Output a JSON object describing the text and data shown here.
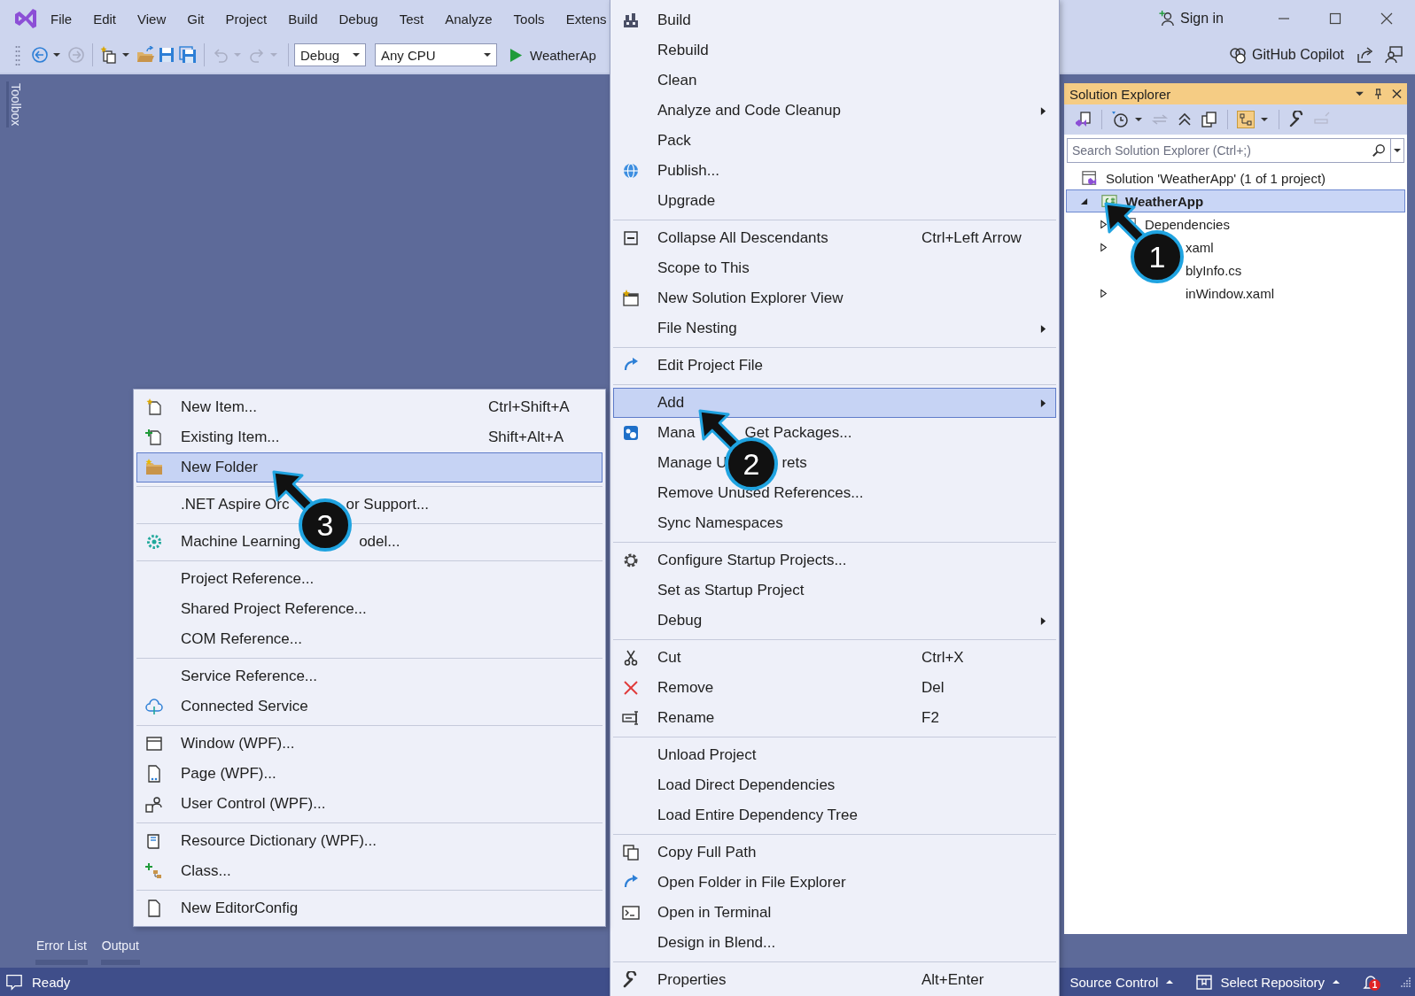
{
  "menu_bar": [
    "File",
    "Edit",
    "View",
    "Git",
    "Project",
    "Build",
    "Debug",
    "Test",
    "Analyze",
    "Tools",
    "Extens"
  ],
  "title_bar": {
    "sign_in": "Sign in"
  },
  "toolbar": {
    "configuration": "Debug",
    "platform": "Any CPU",
    "run_target": "WeatherAp",
    "copilot": "GitHub Copilot"
  },
  "toolbox_tab": "Toolbox",
  "solution_explorer": {
    "title": "Solution Explorer",
    "search": {
      "placeholder": "Search Solution Explorer (Ctrl+;)"
    },
    "tree": [
      {
        "label": "Solution 'WeatherApp' (1 of 1 project)",
        "selected": false,
        "children": [
          {
            "label": "WeatherApp",
            "selected": true,
            "expanded": true,
            "children": [
              {
                "label": "Dependencies",
                "selected": false,
                "expanded": false
              },
              {
                "label": "xaml",
                "selected": false,
                "expanded": false,
                "partly_hidden": true
              },
              {
                "label": "blyInfo.cs",
                "selected": false,
                "partly_hidden": true
              },
              {
                "label": "inWindow.xaml",
                "selected": false,
                "expanded": false,
                "partly_hidden": true
              }
            ]
          }
        ]
      }
    ]
  },
  "bottom_tabs": [
    "Error List",
    "Output"
  ],
  "status_bar": {
    "text": "Ready",
    "source_control": "Source Control",
    "repository": "Select Repository",
    "notifications": "1"
  },
  "context_menu": {
    "items": [
      {
        "kind": "item",
        "label": "Build",
        "submenu": false,
        "selected": false
      },
      {
        "kind": "item",
        "label": "Rebuild",
        "submenu": false,
        "selected": false
      },
      {
        "kind": "item",
        "label": "Clean",
        "submenu": false,
        "selected": false
      },
      {
        "kind": "item",
        "label": "Analyze and Code Cleanup",
        "submenu": true,
        "selected": false
      },
      {
        "kind": "item",
        "label": "Pack",
        "submenu": false,
        "selected": false
      },
      {
        "kind": "item",
        "label": "Publish...",
        "submenu": false,
        "selected": false
      },
      {
        "kind": "item",
        "label": "Upgrade",
        "submenu": false,
        "selected": false
      },
      {
        "kind": "separator"
      },
      {
        "kind": "item",
        "label": "Collapse All Descendants",
        "shortcut": "Ctrl+Left Arrow",
        "submenu": false,
        "selected": false
      },
      {
        "kind": "item",
        "label": "Scope to This",
        "submenu": false,
        "selected": false
      },
      {
        "kind": "item",
        "label": "New Solution Explorer View",
        "submenu": false,
        "selected": false
      },
      {
        "kind": "item",
        "label": "File Nesting",
        "submenu": true,
        "selected": false
      },
      {
        "kind": "separator"
      },
      {
        "kind": "item",
        "label": "Edit Project File",
        "submenu": false,
        "selected": false
      },
      {
        "kind": "separator"
      },
      {
        "kind": "item",
        "label": "Add",
        "submenu": true,
        "selected": true
      },
      {
        "kind": "item",
        "label": "Mana",
        "label_after_gap": "Get Packages...",
        "submenu": false,
        "selected": false
      },
      {
        "kind": "item",
        "label": "Manage U",
        "label_after_gap": "rets",
        "submenu": false,
        "selected": false
      },
      {
        "kind": "item",
        "label": "Remove Unused References...",
        "submenu": false,
        "selected": false
      },
      {
        "kind": "item",
        "label": "Sync Namespaces",
        "submenu": false,
        "selected": false
      },
      {
        "kind": "separator"
      },
      {
        "kind": "item",
        "label": "Configure Startup Projects...",
        "submenu": false,
        "selected": false
      },
      {
        "kind": "item",
        "label": "Set as Startup Project",
        "submenu": false,
        "selected": false
      },
      {
        "kind": "item",
        "label": "Debug",
        "submenu": true,
        "selected": false
      },
      {
        "kind": "separator"
      },
      {
        "kind": "item",
        "label": "Cut",
        "shortcut": "Ctrl+X",
        "submenu": false,
        "selected": false
      },
      {
        "kind": "item",
        "label": "Remove",
        "shortcut": "Del",
        "submenu": false,
        "selected": false
      },
      {
        "kind": "item",
        "label": "Rename",
        "shortcut": "F2",
        "submenu": false,
        "selected": false
      },
      {
        "kind": "separator"
      },
      {
        "kind": "item",
        "label": "Unload Project",
        "submenu": false,
        "selected": false
      },
      {
        "kind": "item",
        "label": "Load Direct Dependencies",
        "submenu": false,
        "selected": false
      },
      {
        "kind": "item",
        "label": "Load Entire Dependency Tree",
        "submenu": false,
        "selected": false
      },
      {
        "kind": "separator"
      },
      {
        "kind": "item",
        "label": "Copy Full Path",
        "submenu": false,
        "selected": false
      },
      {
        "kind": "item",
        "label": "Open Folder in File Explorer",
        "submenu": false,
        "selected": false
      },
      {
        "kind": "item",
        "label": "Open in Terminal",
        "submenu": false,
        "selected": false
      },
      {
        "kind": "item",
        "label": "Design in Blend...",
        "submenu": false,
        "selected": false
      },
      {
        "kind": "separator"
      },
      {
        "kind": "item",
        "label": "Properties",
        "shortcut": "Alt+Enter",
        "submenu": false,
        "selected": false
      }
    ]
  },
  "add_submenu": {
    "items": [
      {
        "kind": "item",
        "label": "New Item...",
        "shortcut": "Ctrl+Shift+A",
        "selected": false
      },
      {
        "kind": "item",
        "label": "Existing Item...",
        "shortcut": "Shift+Alt+A",
        "selected": false
      },
      {
        "kind": "item",
        "label": "New Folder",
        "selected": true
      },
      {
        "kind": "separator"
      },
      {
        "kind": "item",
        "label": ".NET Aspire Orc",
        "label_after_gap": "or Support...",
        "selected": false
      },
      {
        "kind": "separator"
      },
      {
        "kind": "item",
        "label": "Machine Learning",
        "label_after_gap": "odel...",
        "selected": false
      },
      {
        "kind": "separator"
      },
      {
        "kind": "item",
        "label": "Project Reference...",
        "selected": false
      },
      {
        "kind": "item",
        "label": "Shared Project Reference...",
        "selected": false
      },
      {
        "kind": "item",
        "label": "COM Reference...",
        "selected": false
      },
      {
        "kind": "separator"
      },
      {
        "kind": "item",
        "label": "Service Reference...",
        "selected": false
      },
      {
        "kind": "item",
        "label": "Connected Service",
        "selected": false
      },
      {
        "kind": "separator"
      },
      {
        "kind": "item",
        "label": "Window (WPF)...",
        "selected": false
      },
      {
        "kind": "item",
        "label": "Page (WPF)...",
        "selected": false
      },
      {
        "kind": "item",
        "label": "User Control (WPF)...",
        "selected": false
      },
      {
        "kind": "separator"
      },
      {
        "kind": "item",
        "label": "Resource Dictionary (WPF)...",
        "selected": false
      },
      {
        "kind": "item",
        "label": "Class...",
        "selected": false
      },
      {
        "kind": "separator"
      },
      {
        "kind": "item",
        "label": "New EditorConfig",
        "selected": false
      }
    ]
  },
  "callouts": [
    {
      "number": "1"
    },
    {
      "number": "2"
    },
    {
      "number": "3"
    }
  ]
}
